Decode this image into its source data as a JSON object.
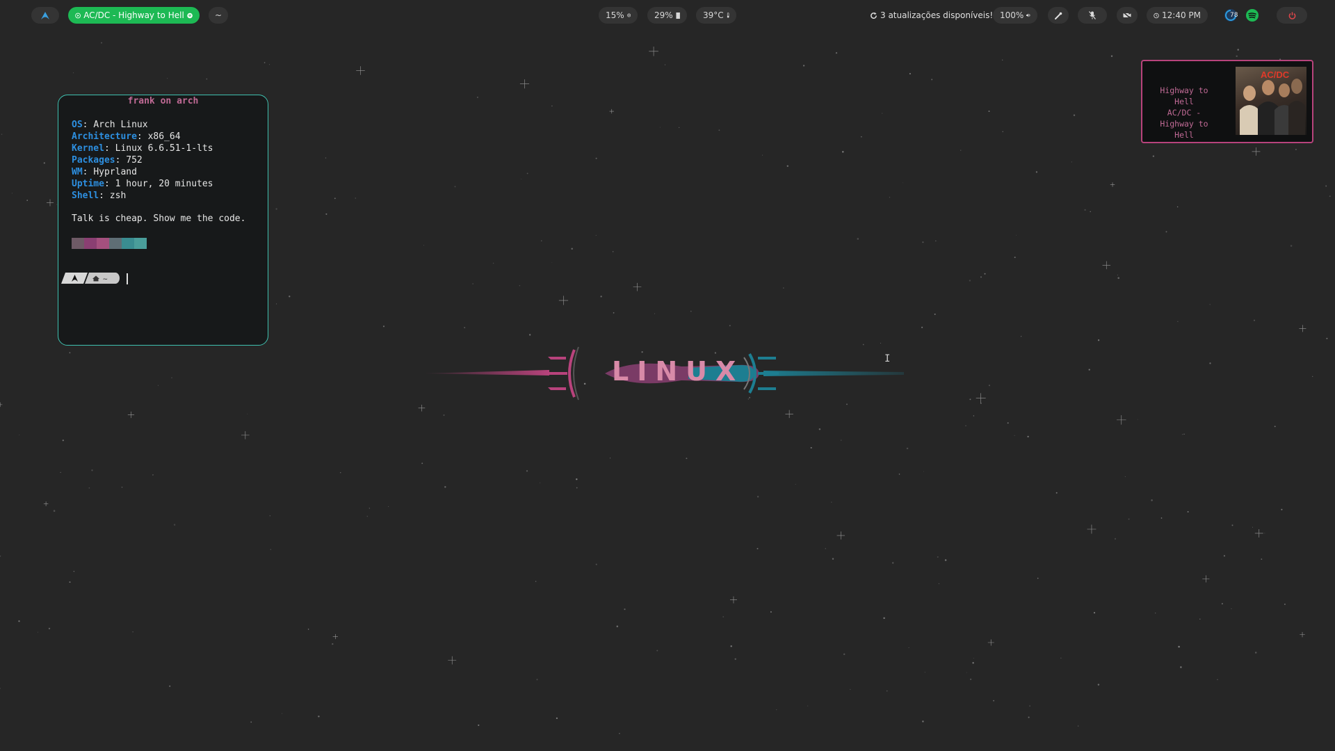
{
  "topbar": {
    "launcher_icon": "arch-logo-icon",
    "media": {
      "label": "AC/DC - Highway to Hell",
      "play_icon": "play-circle-icon",
      "app_icon": "spotify-icon"
    },
    "workspace_label": "~",
    "cpu": {
      "value": "15%",
      "icon": "cpu-icon"
    },
    "memory": {
      "value": "29%",
      "icon": "memory-icon"
    },
    "temperature": {
      "value": "39°C",
      "icon": "thermometer-icon"
    },
    "updates": {
      "text": "3 atualizações disponíveis!!!",
      "icon": "refresh-icon"
    },
    "volume": {
      "value": "100%",
      "icon": "speaker-icon"
    },
    "clock": {
      "time": "12:40 PM",
      "icon": "clock-icon"
    },
    "tray_badge": "78",
    "colors": {
      "pill": "#343434",
      "spotify_green": "#1db954",
      "power_red": "#e0464a"
    }
  },
  "terminal": {
    "title": "frank on arch",
    "info": [
      {
        "key": "OS",
        "value": "Arch Linux"
      },
      {
        "key": "Architecture",
        "value": "x86_64"
      },
      {
        "key": "Kernel",
        "value": "Linux 6.6.51-1-lts"
      },
      {
        "key": "Packages",
        "value": "752"
      },
      {
        "key": "WM",
        "value": "Hyprland"
      },
      {
        "key": "Uptime",
        "value": "1 hour, 20 minutes"
      },
      {
        "key": "Shell",
        "value": "zsh"
      }
    ],
    "quote": "Talk is cheap. Show me the code.",
    "palette": [
      "#6e5a66",
      "#8a3f72",
      "#a4507e",
      "#5f6e75",
      "#3a8d91",
      "#4a9e9b"
    ],
    "prompt_dir": "~",
    "border_color": "#3fc1b0"
  },
  "music_widget": {
    "song": "Highway to Hell",
    "artist_song": "AC/DC - Highway to Hell",
    "album_logo": "AC/DC",
    "border_color": "#b8437c"
  },
  "wallpaper": {
    "logo_text": "LINUX",
    "colors": {
      "pink": "#b8437c",
      "teal": "#1d7e91"
    }
  }
}
